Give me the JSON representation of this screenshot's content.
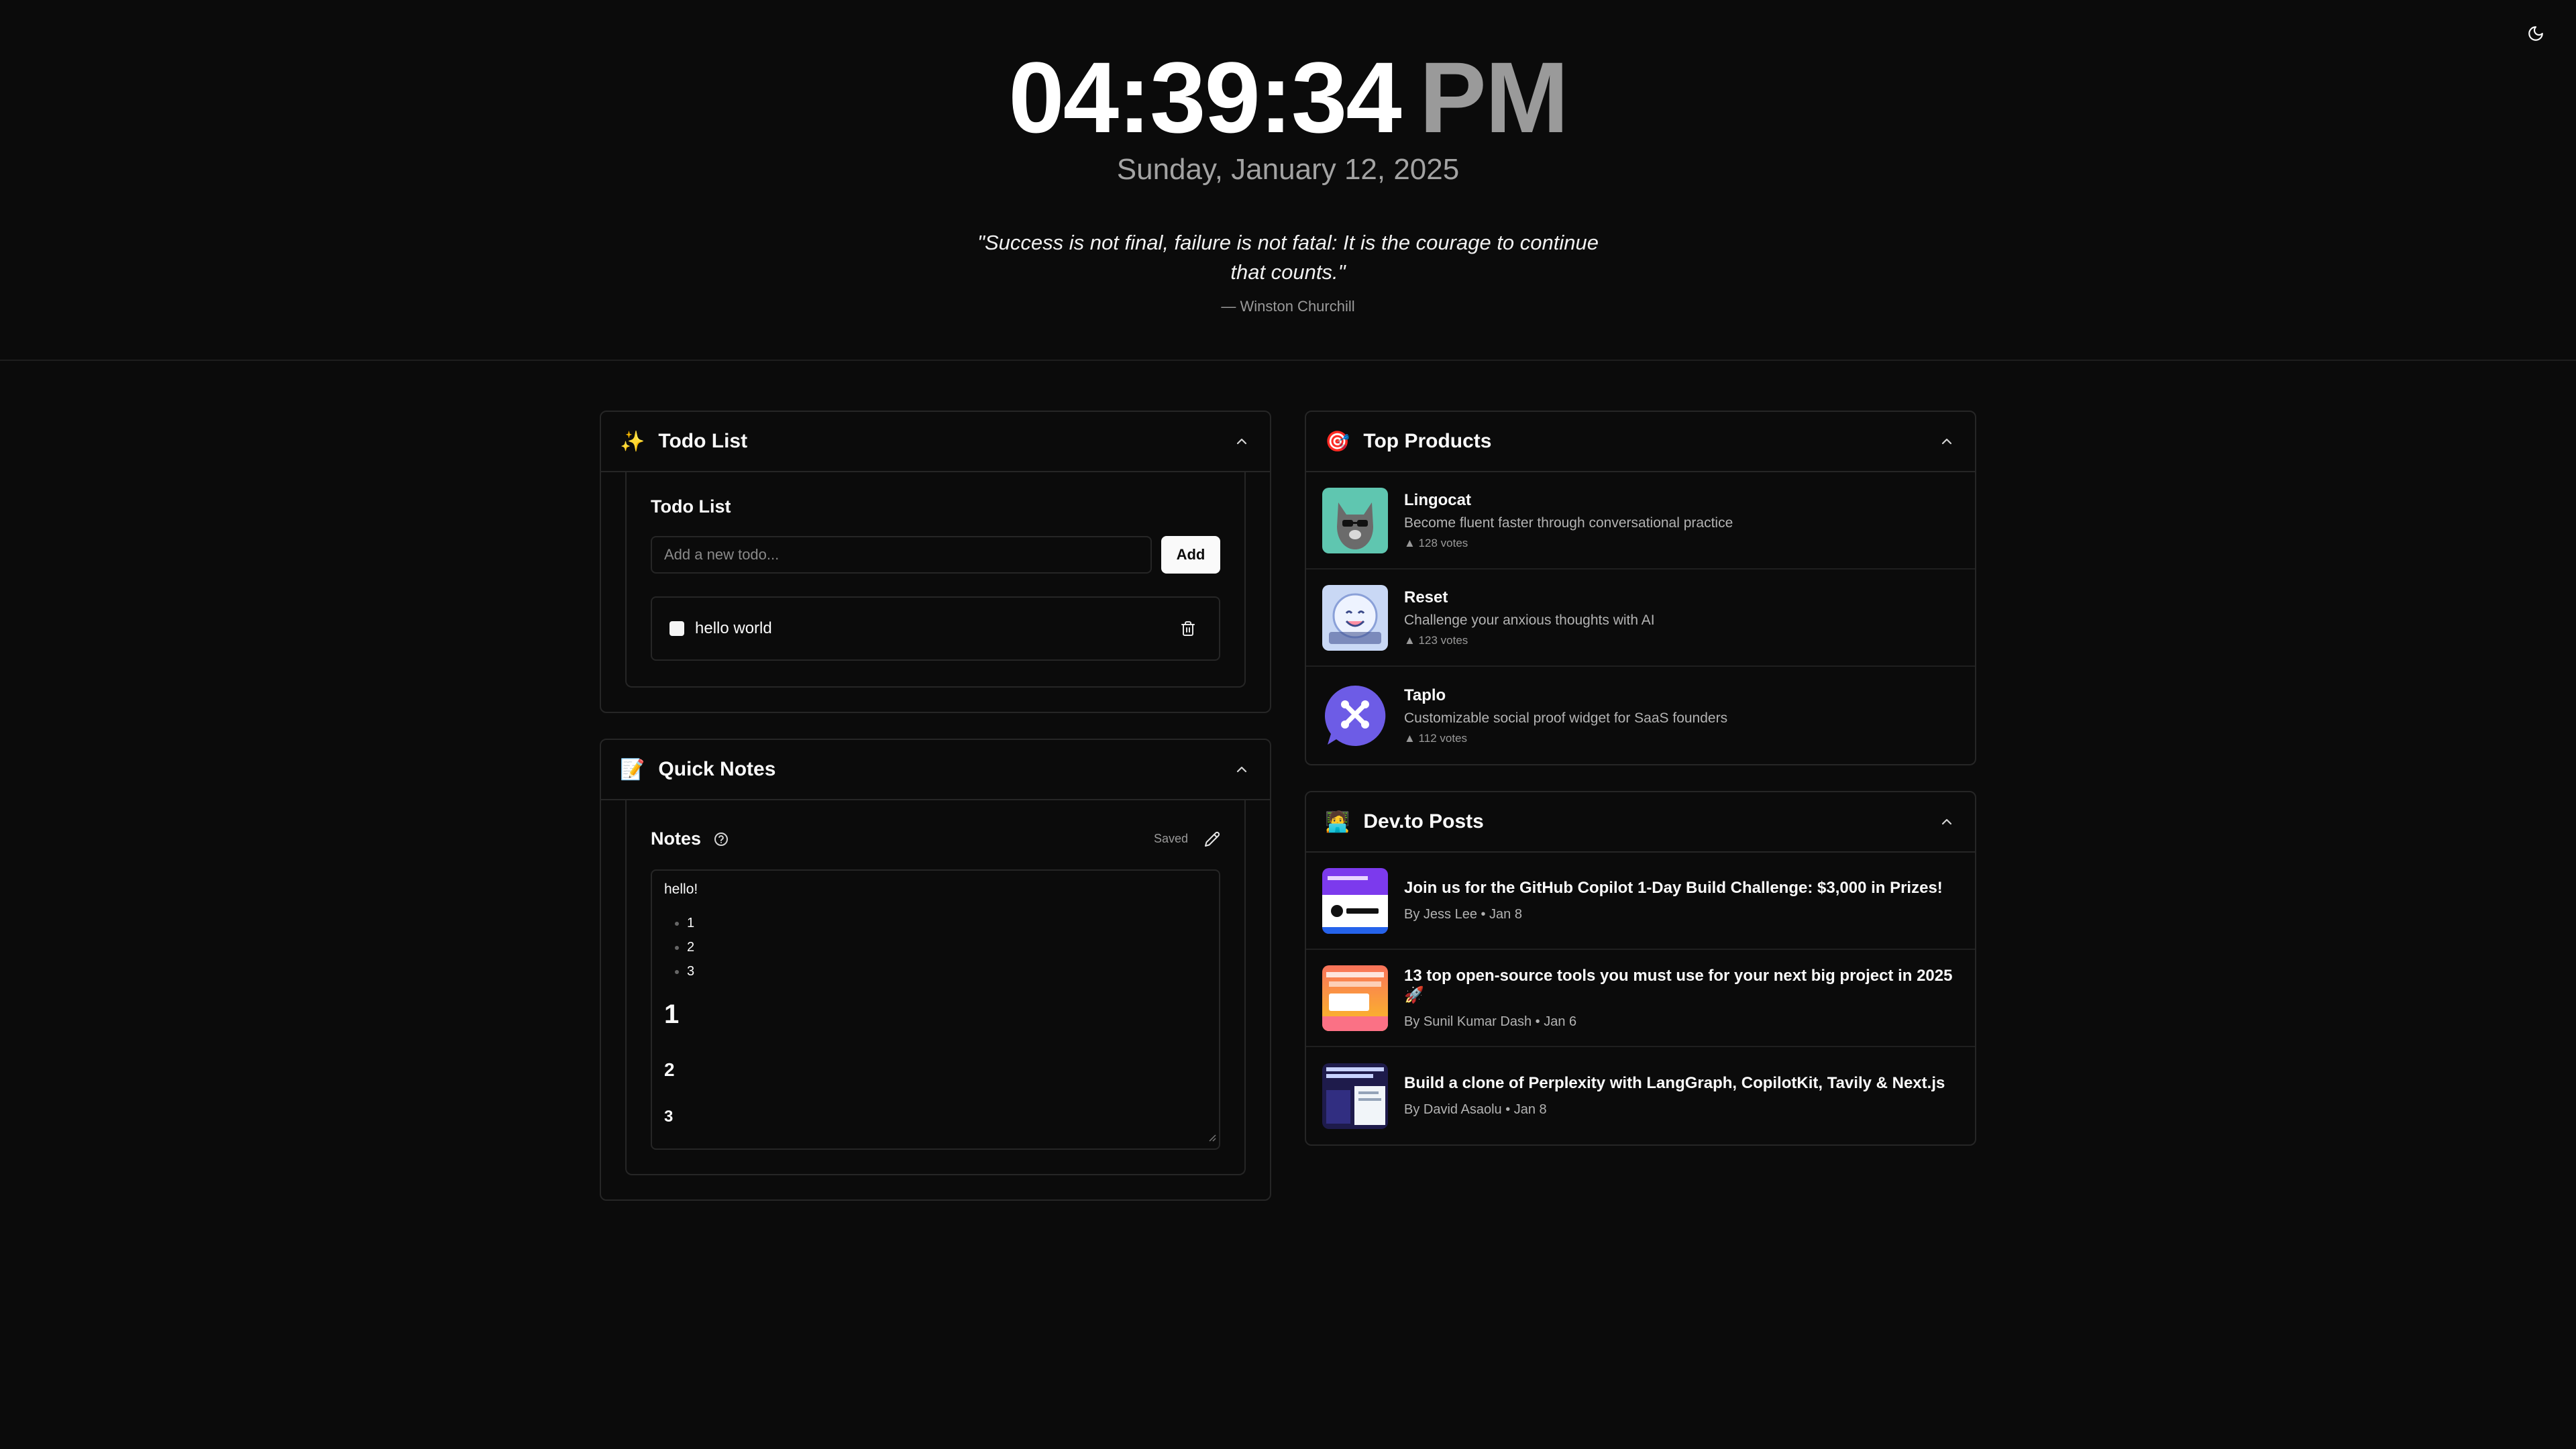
{
  "clock": {
    "time": "04:39:34",
    "ampm": "PM"
  },
  "date": "Sunday, January 12, 2025",
  "quote": {
    "text": "\"Success is not final, failure is not fatal: It is the courage to continue that counts.\"",
    "author": "— Winston Churchill"
  },
  "todo": {
    "emoji": "✨",
    "title": "Todo List",
    "subtitle": "Todo List",
    "input_placeholder": "Add a new todo...",
    "add_label": "Add",
    "items": [
      {
        "text": "hello world",
        "checked": false
      }
    ]
  },
  "notes": {
    "emoji": "📝",
    "title": "Quick Notes",
    "subtitle": "Notes",
    "status": "Saved",
    "content": {
      "para": "hello!",
      "bullets": [
        "1",
        "2",
        "3"
      ],
      "h1": "1",
      "h2": "2",
      "h3": "3"
    }
  },
  "products": {
    "emoji": "🎯",
    "title": "Top Products",
    "items": [
      {
        "name": "Lingocat",
        "tagline": "Become fluent faster through conversational practice",
        "votes": "▲ 128 votes",
        "thumb_color": "#5fc6b0"
      },
      {
        "name": "Reset",
        "tagline": "Challenge your anxious thoughts with AI",
        "votes": "▲ 123 votes",
        "thumb_color": "#c9d8f5"
      },
      {
        "name": "Taplo",
        "tagline": "Customizable social proof widget for SaaS founders",
        "votes": "▲ 112 votes",
        "thumb_color": "#6d5ce6"
      }
    ]
  },
  "devto": {
    "emoji": "🧑‍💻",
    "title": "Dev.to Posts",
    "items": [
      {
        "title": "Join us for the GitHub Copilot 1-Day Build Challenge: $3,000 in Prizes!",
        "meta": "By Jess Lee • Jan 8",
        "thumb_color": "#7c3aed"
      },
      {
        "title": "13 top open-source tools you must use for your next big project in 2025🚀",
        "meta": "By Sunil Kumar Dash • Jan 6",
        "thumb_color": "#f97360"
      },
      {
        "title": "Build a clone of Perplexity with LangGraph, CopilotKit, Tavily & Next.js",
        "meta": "By David Asaolu • Jan 8",
        "thumb_color": "#1e1b4b"
      }
    ]
  },
  "colors": {
    "background": "#0b0b0b",
    "border": "#262626",
    "muted": "#9a9a9a"
  }
}
